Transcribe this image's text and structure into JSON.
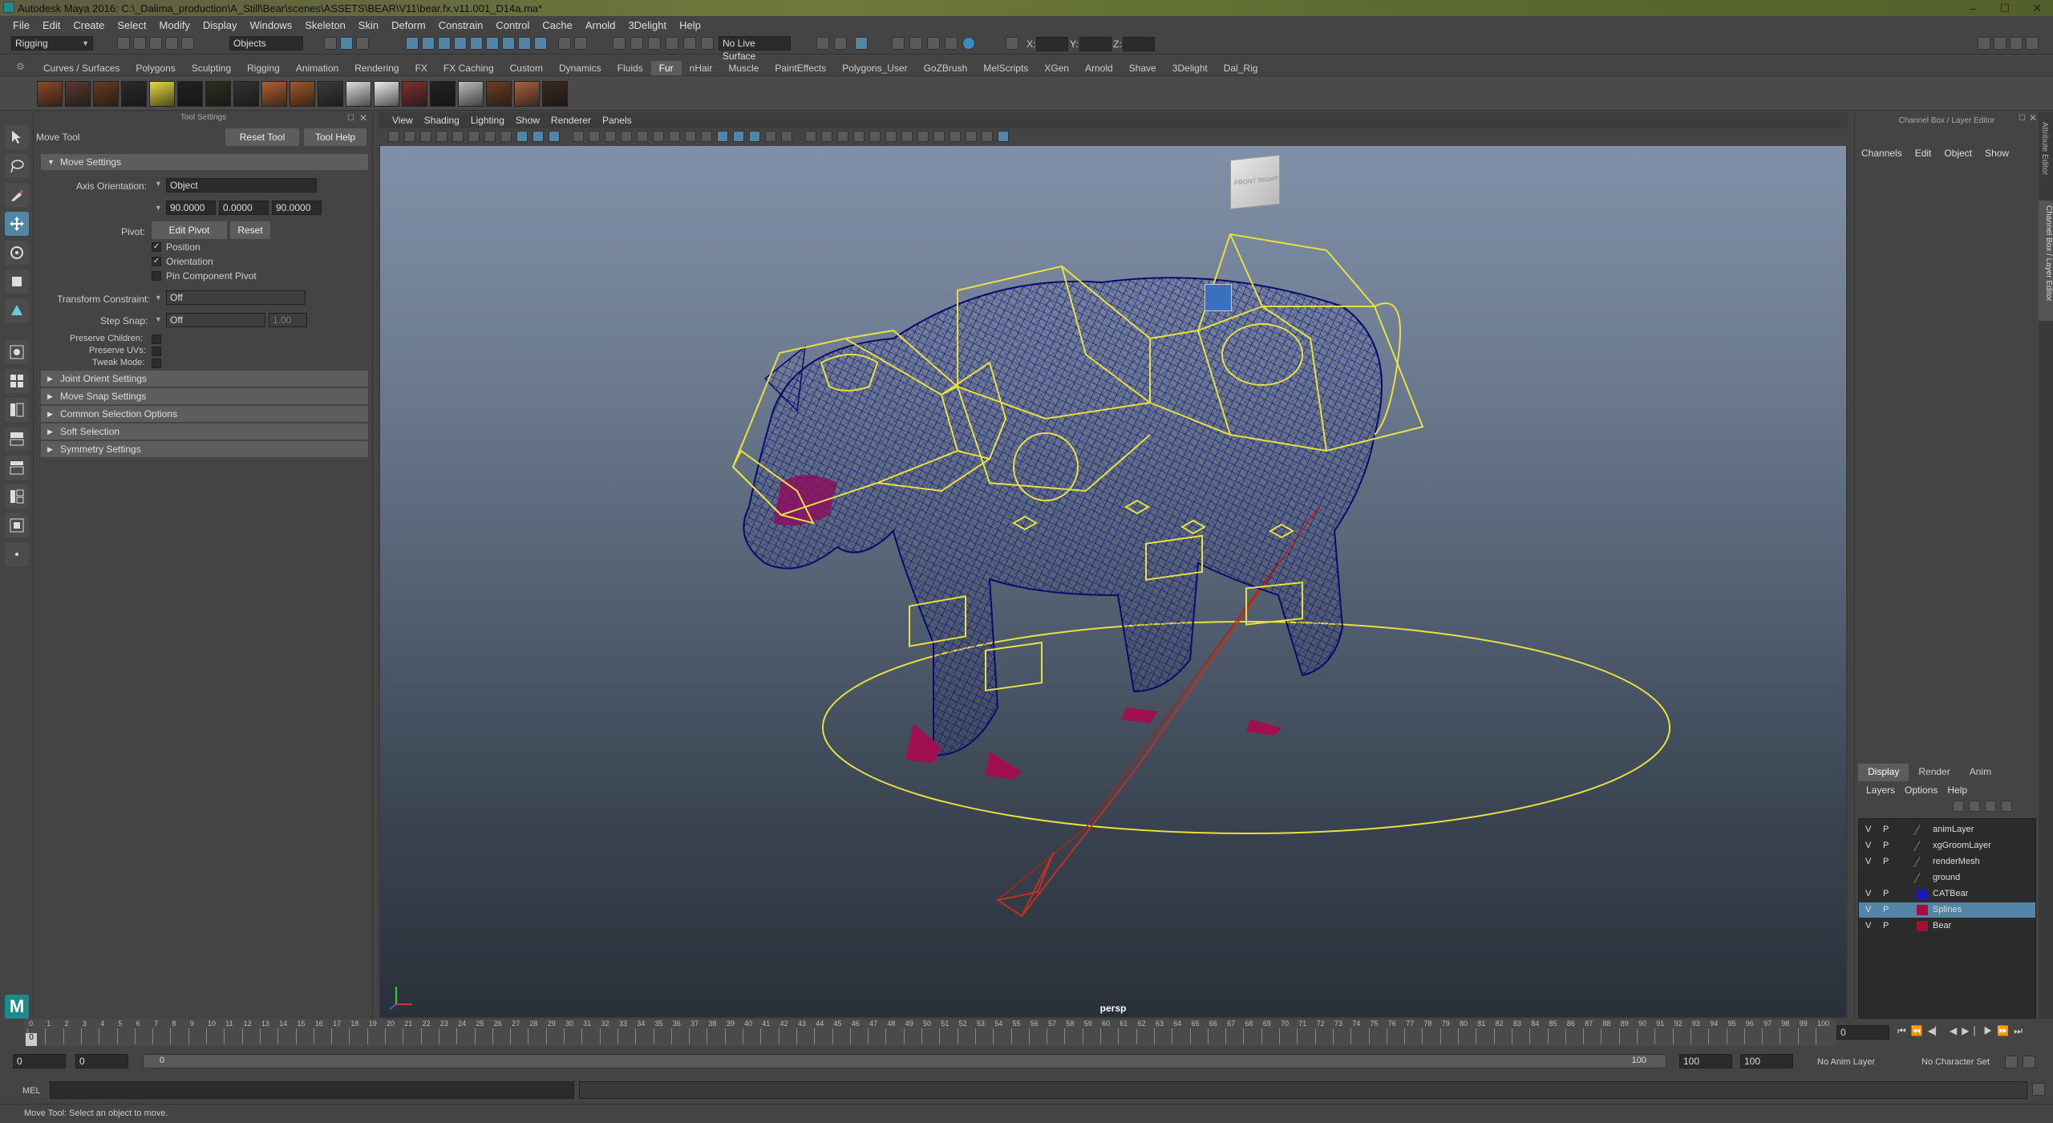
{
  "window": {
    "title": "Autodesk Maya 2016: C:\\_Dalima_production\\A_Still\\Bear\\scenes\\ASSETS\\BEAR\\V11\\bear.fx.v11.001_D14a.ma*"
  },
  "menus": [
    "File",
    "Edit",
    "Create",
    "Select",
    "Modify",
    "Display",
    "Windows",
    "Skeleton",
    "Skin",
    "Deform",
    "Constrain",
    "Control",
    "Cache",
    "Arnold",
    "3Delight",
    "Help"
  ],
  "status": {
    "mode": "Rigging",
    "selection_mask": "Objects",
    "live_surface": "No Live Surface",
    "x_label": "X:",
    "y_label": "Y:",
    "z_label": "Z:"
  },
  "shelf_tabs": [
    "Curves / Surfaces",
    "Polygons",
    "Sculpting",
    "Rigging",
    "Animation",
    "Rendering",
    "FX",
    "FX Caching",
    "Custom",
    "Dynamics",
    "Fluids",
    "Fur",
    "nHair",
    "Muscle",
    "PaintEffects",
    "Polygons_User",
    "GoZBrush",
    "MelScripts",
    "XGen",
    "Arnold",
    "Shave",
    "3Delight",
    "Dal_Rig"
  ],
  "active_shelf": "Fur",
  "fur_swatch_colors": [
    "#8a4a2a",
    "#5a3a30",
    "#6a3a20",
    "#2a2a2a",
    "#e8d840",
    "#222",
    "#2a3020",
    "#333",
    "#b06030",
    "#a05828",
    "#3a3a3a",
    "#ddd",
    "#eee",
    "#803030",
    "#222",
    "#bbb",
    "#6a4020",
    "#aa6040",
    "#3a2a20"
  ],
  "tool_settings": {
    "header": "Tool Settings",
    "tool_name": "Move Tool",
    "reset_tool": "Reset Tool",
    "tool_help": "Tool Help",
    "move_settings": "Move Settings",
    "axis_orientation_label": "Axis Orientation:",
    "axis_orientation_value": "Object",
    "rot_x": "90.0000",
    "rot_y": "0.0000",
    "rot_z": "90.0000",
    "pivot_label": "Pivot:",
    "edit_pivot": "Edit Pivot",
    "reset": "Reset",
    "position": "Position",
    "orientation": "Orientation",
    "pin_component_pivot": "Pin Component Pivot",
    "transform_constraint_label": "Transform Constraint:",
    "transform_constraint_value": "Off",
    "step_snap_label": "Step Snap:",
    "step_snap_value": "Off",
    "step_snap_amount": "1.00",
    "preserve_children": "Preserve Children:",
    "preserve_uvs": "Preserve UVs:",
    "tweak_mode": "Tweak Mode:",
    "sections": [
      "Joint Orient Settings",
      "Move Snap Settings",
      "Common Selection Options",
      "Soft Selection",
      "Symmetry Settings"
    ]
  },
  "viewport": {
    "menus": [
      "View",
      "Shading",
      "Lighting",
      "Show",
      "Renderer",
      "Panels"
    ],
    "camera": "persp",
    "viewcube_front": "FRONT",
    "viewcube_right": "RIGHT"
  },
  "channel_box": {
    "header": "Channel Box / Layer Editor",
    "menus": [
      "Channels",
      "Edit",
      "Object",
      "Show"
    ],
    "layer_tabs": [
      "Display",
      "Render",
      "Anim"
    ],
    "layer_menus": [
      "Layers",
      "Options",
      "Help"
    ],
    "layers": [
      {
        "v": "V",
        "p": "P",
        "name": "animLayer",
        "color": "",
        "selected": false
      },
      {
        "v": "V",
        "p": "P",
        "name": "xgGroomLayer",
        "color": "",
        "selected": false
      },
      {
        "v": "V",
        "p": "P",
        "name": "renderMesh",
        "color": "",
        "selected": false
      },
      {
        "v": "",
        "p": "",
        "name": "ground",
        "color": "",
        "selected": false
      },
      {
        "v": "V",
        "p": "P",
        "name": "CATBear",
        "color": "#1a1ab0",
        "selected": false
      },
      {
        "v": "V",
        "p": "P",
        "name": "Splines",
        "color": "#a01040",
        "selected": true
      },
      {
        "v": "V",
        "p": "P",
        "name": "Bear",
        "color": "#a01030",
        "selected": false
      }
    ],
    "side_tabs": [
      "Attribute Editor",
      "Channel Box / Layer Editor"
    ]
  },
  "timeline": {
    "ticks": [
      "0",
      "1",
      "2",
      "3",
      "4",
      "5",
      "6",
      "7",
      "8",
      "9",
      "10",
      "11",
      "12",
      "13",
      "14",
      "15",
      "16",
      "17",
      "18",
      "19",
      "20",
      "21",
      "22",
      "23",
      "24",
      "25",
      "26",
      "27",
      "28",
      "29",
      "30",
      "31",
      "32",
      "33",
      "34",
      "35",
      "36",
      "37",
      "38",
      "39",
      "40",
      "41",
      "42",
      "43",
      "44",
      "45",
      "46",
      "47",
      "48",
      "49",
      "50",
      "51",
      "52",
      "53",
      "54",
      "55",
      "56",
      "57",
      "58",
      "59",
      "60",
      "61",
      "62",
      "63",
      "64",
      "65",
      "66",
      "67",
      "68",
      "69",
      "70",
      "71",
      "72",
      "73",
      "74",
      "75",
      "76",
      "77",
      "78",
      "79",
      "80",
      "81",
      "82",
      "83",
      "84",
      "85",
      "86",
      "87",
      "88",
      "89",
      "90",
      "91",
      "92",
      "93",
      "94",
      "95",
      "96",
      "97",
      "98",
      "99",
      "100"
    ],
    "current_frame": "0",
    "current_frame_field": "0"
  },
  "range": {
    "start": "0",
    "playback_start": "0",
    "range_start_label": "0",
    "range_end_label": "100",
    "playback_end": "100",
    "end": "100",
    "anim_layer": "No Anim Layer",
    "character_set": "No Character Set"
  },
  "command_line": {
    "mel": "MEL"
  },
  "help_line": "Move Tool: Select an object to move."
}
